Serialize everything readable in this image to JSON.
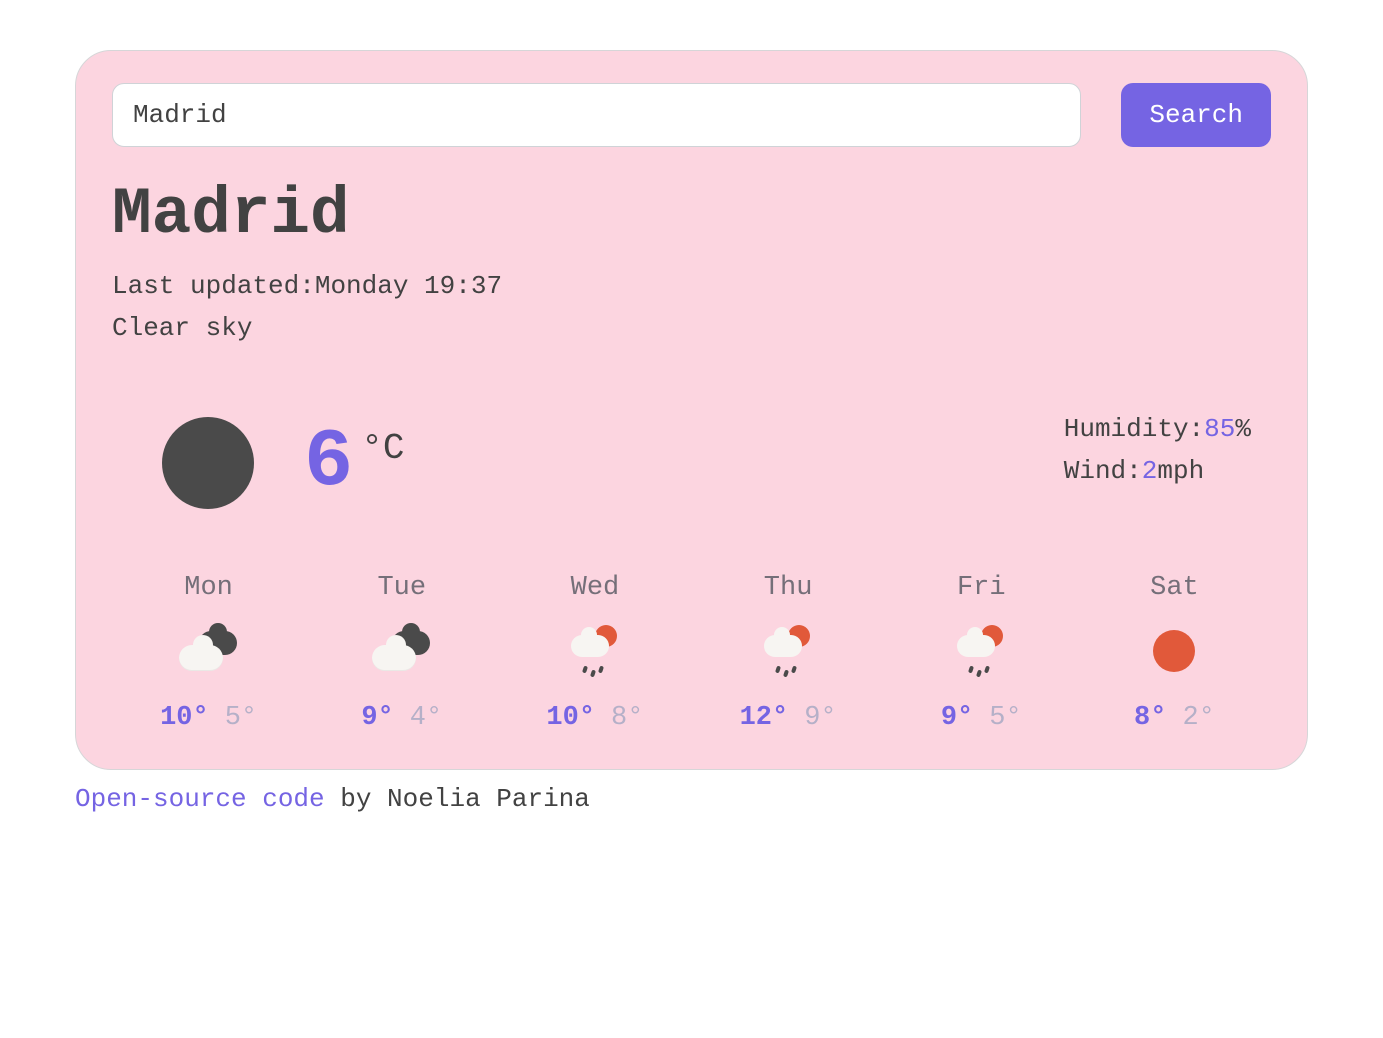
{
  "search": {
    "value": "Madrid",
    "button_label": "Search"
  },
  "city": "Madrid",
  "last_updated_label": "Last updated:",
  "last_updated_value": "Monday 19:37",
  "condition": "Clear sky",
  "current": {
    "icon": "moon-icon",
    "temperature": "6",
    "unit": "°C",
    "humidity_label": "Humidity:",
    "humidity_value": "85",
    "humidity_suffix": "%",
    "wind_label": "Wind:",
    "wind_value": "2",
    "wind_suffix": "mph"
  },
  "forecast": [
    {
      "day": "Mon",
      "icon": "clouds",
      "hi": "10°",
      "lo": "5°"
    },
    {
      "day": "Tue",
      "icon": "clouds",
      "hi": "9°",
      "lo": "4°"
    },
    {
      "day": "Wed",
      "icon": "showers",
      "hi": "10°",
      "lo": "8°"
    },
    {
      "day": "Thu",
      "icon": "showers",
      "hi": "12°",
      "lo": "9°"
    },
    {
      "day": "Fri",
      "icon": "showers",
      "hi": "9°",
      "lo": "5°"
    },
    {
      "day": "Sat",
      "icon": "sun",
      "hi": "8°",
      "lo": "2°"
    }
  ],
  "footer": {
    "link_text": "Open-source code",
    "by_text": " by Noelia Parina"
  }
}
